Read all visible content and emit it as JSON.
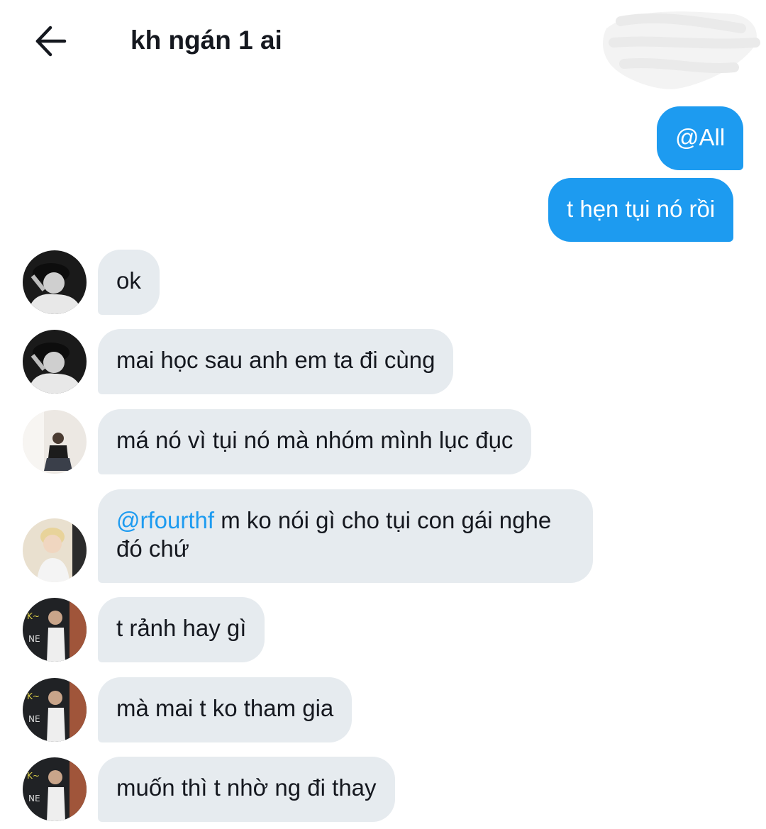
{
  "header": {
    "title": "kh ngán 1 ai"
  },
  "messages": {
    "outgoing": [
      {
        "text": "@All"
      },
      {
        "text": "t hẹn tụi nó rồi"
      }
    ],
    "incoming": [
      {
        "text": "ok",
        "avatar": "avatar-cap-person-bw"
      },
      {
        "text": "mai học sau anh em ta đi cùng",
        "avatar": "avatar-cap-person-bw"
      },
      {
        "text": "má nó vì tụi nó mà nhóm mình lục đục",
        "avatar": "avatar-sitting-person"
      },
      {
        "mention": "@rfourthf",
        "text": " m ko nói gì cho tụi con gái nghe đó chứ",
        "avatar": "avatar-blond-person"
      },
      {
        "text": "t rảnh hay gì",
        "avatar": "avatar-neon-sign-person"
      },
      {
        "text": "mà mai t ko tham gia",
        "avatar": "avatar-neon-sign-person"
      },
      {
        "text": "muốn thì t nhờ ng đi thay",
        "avatar": "avatar-neon-sign-person"
      }
    ]
  },
  "colors": {
    "outgoing_bubble": "#1d9bf0",
    "incoming_bubble": "#e6ebef",
    "mention": "#1d9bf0"
  }
}
